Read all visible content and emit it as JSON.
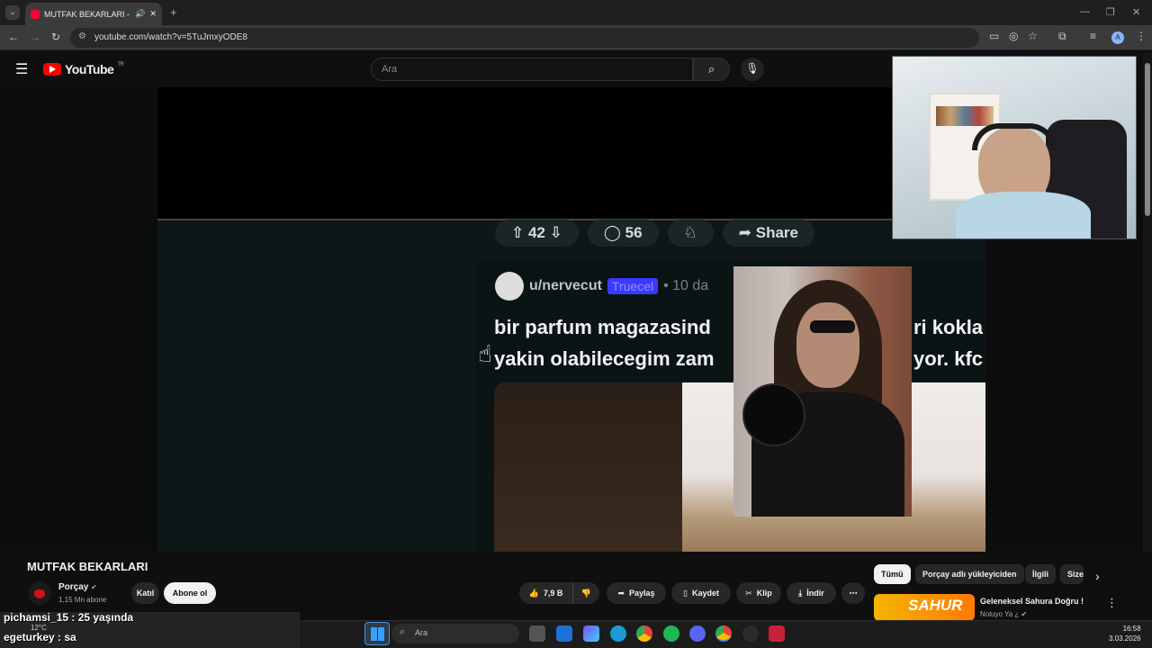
{
  "browser": {
    "tab_title": "MUTFAK BEKARLARI - YouTube",
    "url": "youtube.com/watch?v=5TuJmxyODE8",
    "profile_initial": "A"
  },
  "youtube": {
    "logo_text": "YouTube",
    "region": "TR",
    "search_placeholder": "Ara"
  },
  "video_frame": {
    "reddit_votes": "42",
    "reddit_comments": "56",
    "reddit_share": "Share",
    "post_user": "u/nervecut",
    "post_flair": "Truecel",
    "post_age": "• 10 da",
    "post_line1": "bir parfum magazasind",
    "post_line1_tail": "ri kokla",
    "post_line2": "yakin olabilecegim zam",
    "post_line2_tail": "yor. kfc"
  },
  "video_info": {
    "title": "MUTFAK BEKARLARI",
    "channel": "Porçay",
    "subscribers": "1,15 Mn abone",
    "join_label": "Katıl",
    "subscribe_label": "Abone ol",
    "likes": "7,9 B",
    "share_label": "Paylaş",
    "save_label": "Kaydet",
    "clip_label": "Klip",
    "download_label": "İndir"
  },
  "chips": [
    "Tümü",
    "Porçay adlı yükleyiciden",
    "İlgili",
    "Size"
  ],
  "recommendation": {
    "thumb_text": "SAHUR",
    "title": "Geleneksel Sahura Doğru !",
    "channel": "Noluyo Ya ¿"
  },
  "chat": [
    {
      "text": "pichamsi_15 : 25 yaşında"
    },
    {
      "text": "egeturkey : sa"
    }
  ],
  "taskbar": {
    "search_placeholder": "Ara",
    "weather": "12°C",
    "time": "16:58",
    "date": "3.03.2026"
  },
  "colors": {
    "youtube_red": "#ff0000",
    "flair_blue": "#3a3aff",
    "dark_bg": "#0f0f0f"
  }
}
